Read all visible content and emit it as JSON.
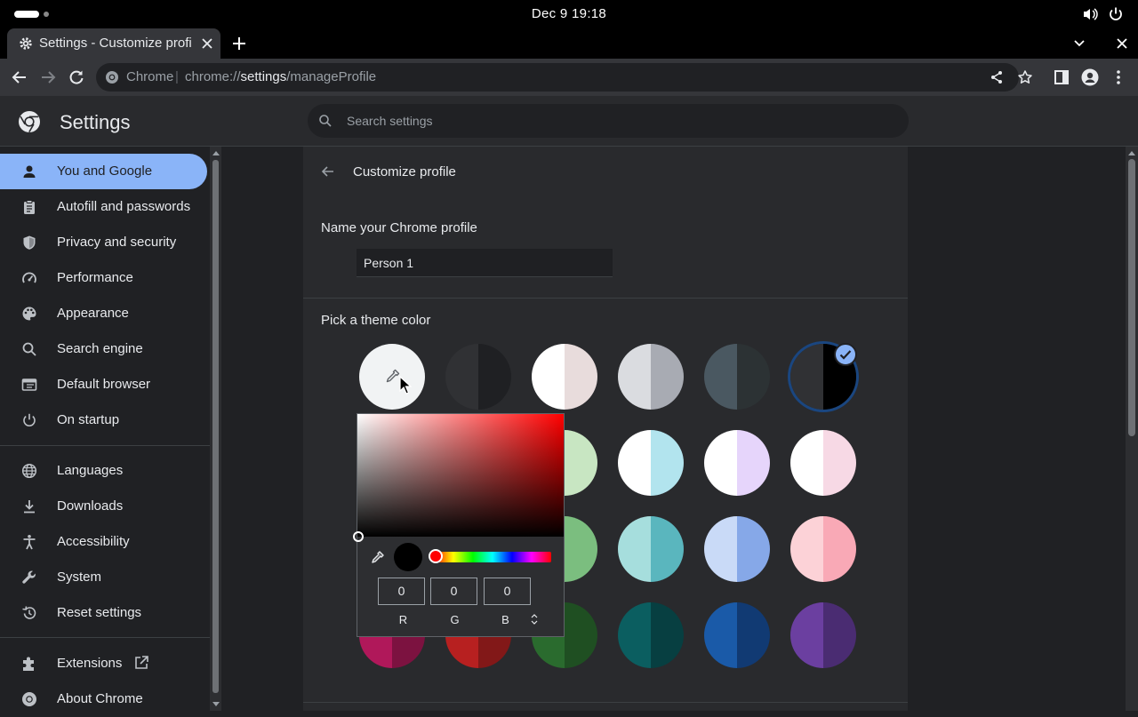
{
  "system": {
    "clock": "Dec 9  19:18"
  },
  "tab": {
    "title": "Settings - Customize profile"
  },
  "omnibox": {
    "chrome_label": "Chrome",
    "separator": "|",
    "url_scheme": "chrome://",
    "url_host": "settings",
    "url_path": "/manageProfile"
  },
  "header": {
    "title": "Settings",
    "search_placeholder": "Search settings"
  },
  "sidebar": {
    "items": [
      {
        "label": "You and Google",
        "icon": "person-icon"
      },
      {
        "label": "Autofill and passwords",
        "icon": "clipboard-icon"
      },
      {
        "label": "Privacy and security",
        "icon": "shield-icon"
      },
      {
        "label": "Performance",
        "icon": "gauge-icon"
      },
      {
        "label": "Appearance",
        "icon": "palette-icon"
      },
      {
        "label": "Search engine",
        "icon": "search-icon"
      },
      {
        "label": "Default browser",
        "icon": "browser-icon"
      },
      {
        "label": "On startup",
        "icon": "power-icon"
      },
      {
        "label": "Languages",
        "icon": "globe-icon"
      },
      {
        "label": "Downloads",
        "icon": "download-icon"
      },
      {
        "label": "Accessibility",
        "icon": "accessibility-icon"
      },
      {
        "label": "System",
        "icon": "wrench-icon"
      },
      {
        "label": "Reset settings",
        "icon": "history-icon"
      },
      {
        "label": "Extensions",
        "icon": "puzzle-icon"
      },
      {
        "label": "About Chrome",
        "icon": "chrome-icon"
      }
    ]
  },
  "page": {
    "title": "Customize profile",
    "name_label": "Name your Chrome profile",
    "name_value": "Person 1",
    "theme_label": "Pick a theme color"
  },
  "theme_colors": [
    {
      "row": 0,
      "col": 1,
      "left": "#303134",
      "right": "#1f2023"
    },
    {
      "row": 0,
      "col": 2,
      "left": "#ffffff",
      "right": "#e8dcdc"
    },
    {
      "row": 0,
      "col": 3,
      "left": "#dadce0",
      "right": "#a8abb3"
    },
    {
      "row": 0,
      "col": 4,
      "left": "#4a5861",
      "right": "#2c3234"
    },
    {
      "row": 0,
      "col": 5,
      "left": "#303134",
      "right": "#000000",
      "selected": true
    },
    {
      "row": 1,
      "col": 2,
      "left": "#ffffff",
      "right": "#c8e6c2"
    },
    {
      "row": 1,
      "col": 3,
      "left": "#ffffff",
      "right": "#b2e4ee"
    },
    {
      "row": 1,
      "col": 4,
      "left": "#ffffff",
      "right": "#e6d5fb"
    },
    {
      "row": 1,
      "col": 5,
      "left": "#ffffff",
      "right": "#f7d9e5"
    },
    {
      "row": 2,
      "col": 2,
      "left": "#a9d6a6",
      "right": "#7bbe7f"
    },
    {
      "row": 2,
      "col": 3,
      "left": "#a6dedd",
      "right": "#5ab6be"
    },
    {
      "row": 2,
      "col": 4,
      "left": "#c9daf7",
      "right": "#86a8e8"
    },
    {
      "row": 2,
      "col": 5,
      "left": "#fcd2d7",
      "right": "#f9a9b6"
    },
    {
      "row": 3,
      "col": 0,
      "left": "#b0185a",
      "right": "#7c1240"
    },
    {
      "row": 3,
      "col": 1,
      "left": "#b72020",
      "right": "#821818"
    },
    {
      "row": 3,
      "col": 2,
      "left": "#2a6b2e",
      "right": "#1f4f22"
    },
    {
      "row": 3,
      "col": 3,
      "left": "#0b5e60",
      "right": "#073f41"
    },
    {
      "row": 3,
      "col": 4,
      "left": "#1a5aa8",
      "right": "#113a73"
    },
    {
      "row": 3,
      "col": 5,
      "left": "#6b3fa0",
      "right": "#4a2c72"
    }
  ],
  "color_picker": {
    "r": "0",
    "g": "0",
    "b": "0",
    "r_label": "R",
    "g_label": "G",
    "b_label": "B",
    "current_color": "#000000",
    "hue_color": "#ff0000"
  }
}
